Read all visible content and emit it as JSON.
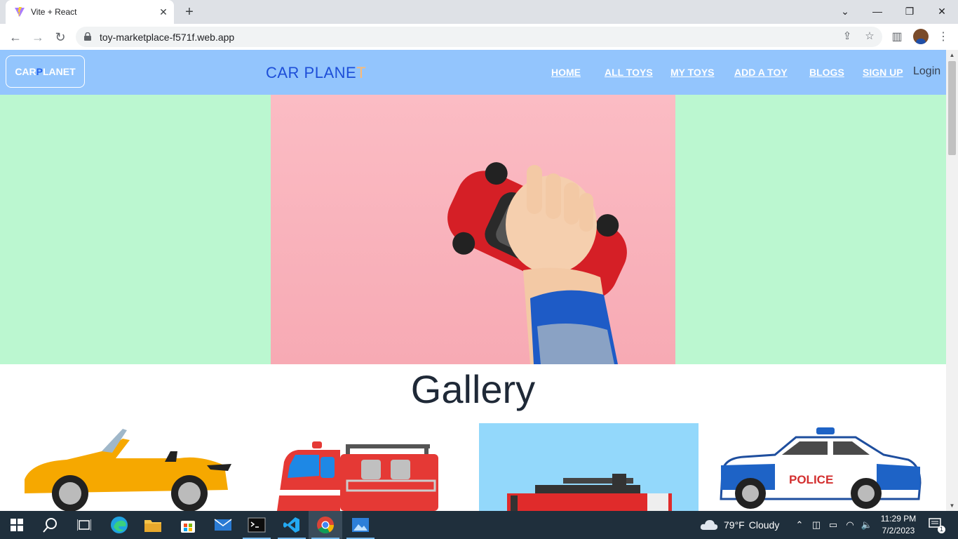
{
  "browser": {
    "tab_title": "Vite + React",
    "url": "toy-marketplace-f571f.web.app"
  },
  "site": {
    "logo_part1": "CAR",
    "logo_part2": "P",
    "logo_part3": "LANET",
    "brand_main": "CAR PLANE",
    "brand_last": "T",
    "nav": {
      "home": "HOME",
      "all_toys": "ALL TOYS",
      "my_toys": "MY TOYS",
      "add_toy": "ADD A TOY",
      "blogs": "BLOGS",
      "sign_up": "SIGN UP",
      "login": "Login"
    },
    "gallery_title": "Gallery",
    "gallery_police_label": "POLICE"
  },
  "taskbar": {
    "temperature": "79°F",
    "weather": "Cloudy",
    "time": "11:29 PM",
    "date": "7/2/2023",
    "notification_count": "1"
  },
  "colors": {
    "nav_bg": "#93c5fd",
    "hero_bg": "#bbf7d0",
    "brand": "#1d4ed8",
    "brand_accent": "#fdba74"
  }
}
